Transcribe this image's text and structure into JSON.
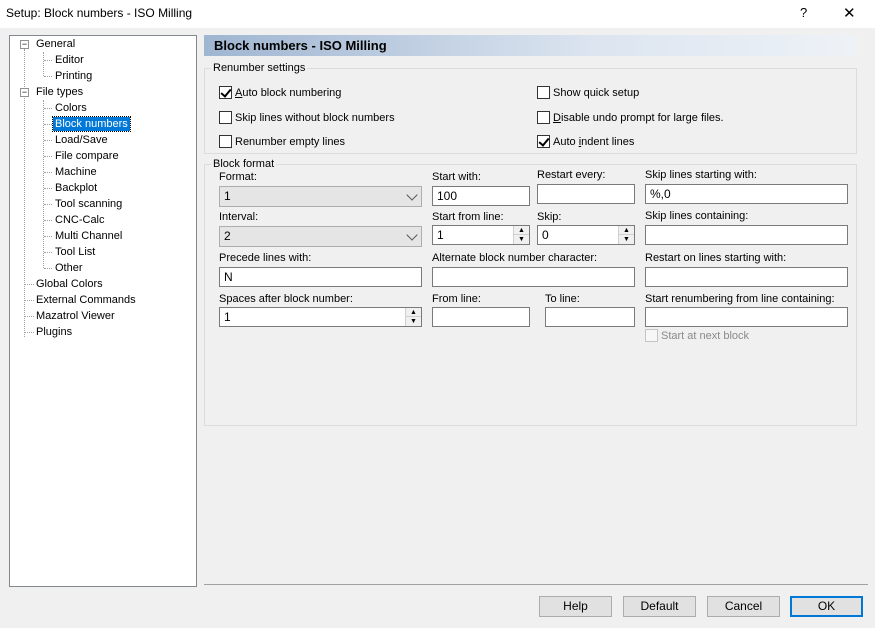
{
  "window": {
    "title": "Setup: Block numbers - ISO Milling",
    "help_glyph": "?",
    "close_glyph": "✕"
  },
  "tree": {
    "items": [
      {
        "label": "General"
      },
      {
        "label": "Editor"
      },
      {
        "label": "Printing"
      },
      {
        "label": "File types"
      },
      {
        "label": "Colors"
      },
      {
        "label": "Block numbers"
      },
      {
        "label": "Load/Save"
      },
      {
        "label": "File compare"
      },
      {
        "label": "Machine"
      },
      {
        "label": "Backplot"
      },
      {
        "label": "Tool scanning"
      },
      {
        "label": "CNC-Calc"
      },
      {
        "label": "Multi Channel"
      },
      {
        "label": "Tool List"
      },
      {
        "label": "Other"
      },
      {
        "label": "Global Colors"
      },
      {
        "label": "External Commands"
      },
      {
        "label": "Mazatrol Viewer"
      },
      {
        "label": "Plugins"
      }
    ],
    "expander_glyph": "−"
  },
  "panel": {
    "title": "Block numbers - ISO Milling"
  },
  "renumber": {
    "legend": "Renumber settings",
    "auto_block_numbering": {
      "pre": "",
      "u": "A",
      "post": "uto block numbering",
      "checked": true
    },
    "skip_lines_without": {
      "label": "Skip lines without block numbers",
      "checked": false
    },
    "renumber_empty": {
      "label": "Renumber empty lines",
      "checked": false
    },
    "show_quick_setup": {
      "label": "Show quick setup",
      "checked": false
    },
    "disable_undo": {
      "pre": "",
      "u": "D",
      "post": "isable undo prompt for large files.",
      "checked": false
    },
    "auto_indent": {
      "pre": "Auto ",
      "u": "i",
      "post": "ndent lines",
      "checked": true
    }
  },
  "block_format": {
    "legend": "Block format",
    "format_label": "Format:",
    "format_value": "1",
    "interval_label": "Interval:",
    "interval_value": "2",
    "precede_label": "Precede lines with:",
    "precede_value": "N",
    "spaces_label": "Spaces after block number:",
    "spaces_value": "1",
    "start_with_label": "Start with:",
    "start_with_value": "100",
    "start_from_label": "Start from line:",
    "start_from_value": "1",
    "alt_char_label": "Alternate block number character:",
    "alt_char_value": "",
    "from_line_label": "From line:",
    "from_line_value": "",
    "restart_every_label": "Restart every:",
    "restart_every_value": "",
    "skip_label": "Skip:",
    "skip_value": "0",
    "to_line_label": "To line:",
    "to_line_value": "",
    "skip_starting_label": "Skip lines starting with:",
    "skip_starting_value": "%,0",
    "skip_containing_label": "Skip lines containing:",
    "skip_containing_value": "",
    "restart_on_label": "Restart on lines starting with:",
    "restart_on_value": "",
    "start_renumber_label": "Start renumbering from line containing:",
    "start_renumber_value": "",
    "start_next_block": {
      "label": "Start at next block",
      "checked": false,
      "disabled": true
    }
  },
  "buttons": {
    "help": "Help",
    "default": "Default",
    "cancel": "Cancel",
    "ok": "OK"
  }
}
